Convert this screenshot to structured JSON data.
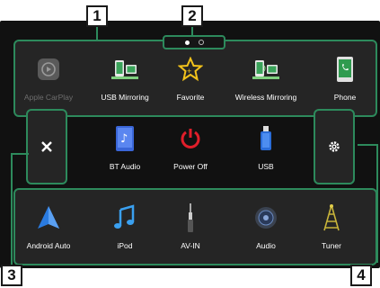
{
  "callouts": [
    "1",
    "2",
    "3",
    "4"
  ],
  "page_indicator": {
    "current": 1,
    "total": 2
  },
  "top_row": [
    {
      "label": "Apple CarPlay",
      "icon": "apple-carplay-icon",
      "enabled": false
    },
    {
      "label": "USB Mirroring",
      "icon": "usb-mirroring-icon",
      "enabled": true
    },
    {
      "label": "Favorite",
      "icon": "favorite-star-icon",
      "enabled": true
    },
    {
      "label": "Wireless Mirroring",
      "icon": "wireless-mirroring-icon",
      "enabled": true
    },
    {
      "label": "Phone",
      "icon": "phone-icon",
      "enabled": true
    }
  ],
  "middle_row": [
    {
      "label": "BT Audio",
      "icon": "bt-audio-icon"
    },
    {
      "label": "Power Off",
      "icon": "power-icon"
    },
    {
      "label": "USB",
      "icon": "usb-drive-icon"
    }
  ],
  "bottom_row": [
    {
      "label": "Android Auto",
      "icon": "android-auto-icon"
    },
    {
      "label": "iPod",
      "icon": "ipod-music-icon"
    },
    {
      "label": "AV-IN",
      "icon": "av-in-icon"
    },
    {
      "label": "Audio",
      "icon": "audio-speaker-icon"
    },
    {
      "label": "Tuner",
      "icon": "tuner-tower-icon"
    }
  ],
  "colors": {
    "accent": "#2d8a5c",
    "background": "#111111"
  }
}
